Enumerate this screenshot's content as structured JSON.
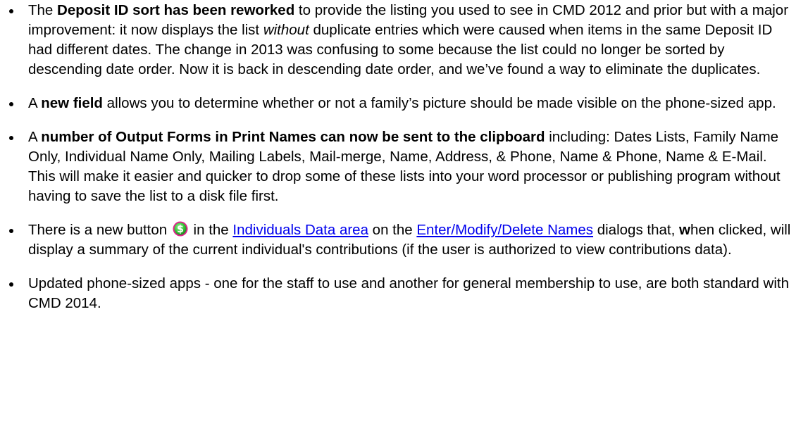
{
  "bullets": [
    {
      "parts": [
        {
          "text": "The "
        },
        {
          "text": "Deposit ID sort has been reworked",
          "bold": true
        },
        {
          "text": " to provide the listing you used to see in CMD 2012 and prior but with a major improvement: it now displays the list "
        },
        {
          "text": "without",
          "italic": true
        },
        {
          "text": " duplicate entries which were caused when items in the same Deposit ID had different dates. The change in 2013 was confusing to some because the list could no longer be sorted by descending date order. Now it is back in descending date order, and we’ve found a way to eliminate the duplicates."
        }
      ]
    },
    {
      "parts": [
        {
          "text": "A "
        },
        {
          "text": "new field",
          "bold": true
        },
        {
          "text": " allows you to determine whether or not a family’s picture should be made visible on the phone-sized app."
        }
      ]
    },
    {
      "parts": [
        {
          "text": "A "
        },
        {
          "text": "number of Output Forms in Print Names can now be sent to the clipboard",
          "bold": true
        },
        {
          "text": " including: Dates Lists, Family Name Only, Individual Name Only, Mailing Labels, Mail-merge, Name, Address, & Phone, Name & Phone, Name & E-Mail. This will make it easier and quicker to drop some of these lists into your word processor or publishing program without having to save the list to a disk file first."
        }
      ]
    },
    {
      "parts": [
        {
          "text": "There is a new button "
        },
        {
          "icon": "dollar-button-icon"
        },
        {
          "text": " in the "
        },
        {
          "text": "Individuals Data area",
          "link": true
        },
        {
          "text": " on the "
        },
        {
          "text": "Enter/Modify/Delete Names",
          "link": true
        },
        {
          "text": " dialogs that, "
        },
        {
          "text": "w",
          "bold": true
        },
        {
          "text": "hen clicked, will display a summary of the current individual's contributions (if the user is authorized to view contributions data)."
        }
      ]
    },
    {
      "parts": [
        {
          "text": "Updated phone-sized apps - one for the staff to use and another for general membership to use, are both standard with CMD 2014."
        }
      ]
    }
  ],
  "colors": {
    "link": "#0000ee",
    "icon_green": "#3cc43c",
    "icon_magenta": "#e0208c"
  }
}
